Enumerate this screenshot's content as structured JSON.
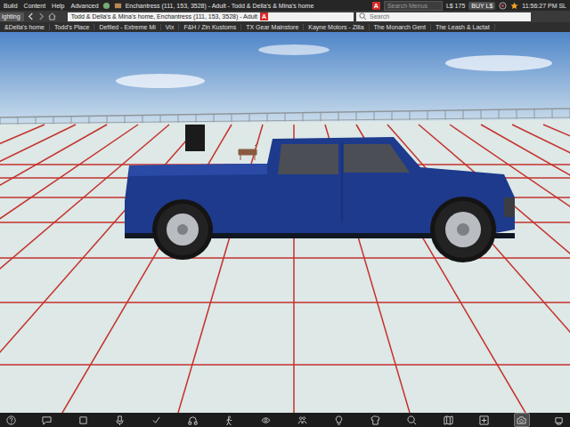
{
  "menu_bar": {
    "items": [
      "Build",
      "Content",
      "Help",
      "Advanced"
    ],
    "location": "Enchantress (111, 153, 3528) - Adult - Todd & Della's & Mina's home",
    "rating_badge": "A",
    "search": {
      "placeholder": "Search Menus"
    },
    "balance": "L$ 175",
    "buy_button": "BUY L$",
    "time": "11:56:27 PM SL"
  },
  "nav_bar": {
    "left_button": "ighting",
    "location": "Todd & Della's & Mina's home, Enchantress (111, 153, 3528) - Adult",
    "rating_badge": "A",
    "search": {
      "placeholder": "Search"
    }
  },
  "favorites": [
    "&Della's home",
    "Todd's Place",
    "Defiled - Extreme Mi",
    "Vix",
    "F&H / Zin Kustoms",
    "TX Gear Mainstore",
    "Kayne Motors - Zilla",
    "The Monarch Gent",
    "The Leash & Lactat"
  ],
  "toolbar": {
    "buttons": [
      {
        "selected": false
      },
      {
        "selected": false
      },
      {
        "selected": false
      },
      {
        "selected": false
      },
      {
        "selected": false
      },
      {
        "selected": false
      },
      {
        "selected": false
      },
      {
        "selected": false
      },
      {
        "selected": false
      },
      {
        "selected": false
      },
      {
        "selected": false
      },
      {
        "selected": false
      },
      {
        "selected": false
      },
      {
        "selected": false
      },
      {
        "selected": true
      },
      {
        "selected": false
      }
    ]
  }
}
